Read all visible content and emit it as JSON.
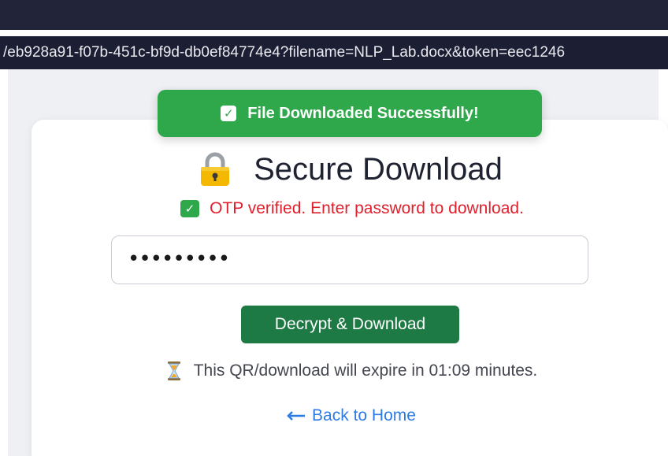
{
  "browser": {
    "url": "/eb928a91-f07b-451c-bf9d-db0ef84774e4?filename=NLP_Lab.docx&token=eec1246"
  },
  "toast": {
    "icon": "check-icon",
    "message": "File Downloaded Successfully!",
    "color": "#2ea84a"
  },
  "card": {
    "title_icon": "lock-icon",
    "title": "Secure Download",
    "otp_status": "OTP verified. Enter password to download.",
    "otp_status_color": "#e0202c",
    "password_value": "•••••••••",
    "decrypt_button_label": "Decrypt & Download",
    "decrypt_button_color": "#1e7a44",
    "expire_icon": "hourglass-icon",
    "expire_text": "This QR/download will expire in 01:09 minutes.",
    "back_link_icon": "left-arrow-icon",
    "back_link_label": "Back to Home",
    "link_color": "#2c7be5"
  }
}
